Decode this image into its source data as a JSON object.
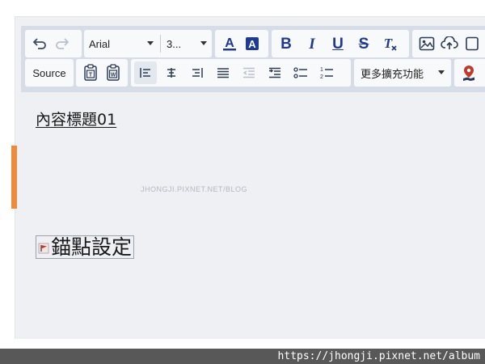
{
  "toolbar": {
    "font_name": "Arial",
    "font_size": "3...",
    "source_label": "Source",
    "more_features_label": "更多擴充功能"
  },
  "editor": {
    "heading": "內容標題01",
    "anchor_text": "錨點設定",
    "watermark": "JHONGJI.PIXNET.NET/BLOG"
  },
  "footer": {
    "url": "https://jhongji.pixnet.net/album"
  },
  "colors": {
    "toolbar_bg": "#d7dde6",
    "editor_bg": "#eef0f4",
    "icon_blue": "#1f3a93",
    "accent_orange": "#ef8a3a",
    "footer_bg": "#585858"
  }
}
